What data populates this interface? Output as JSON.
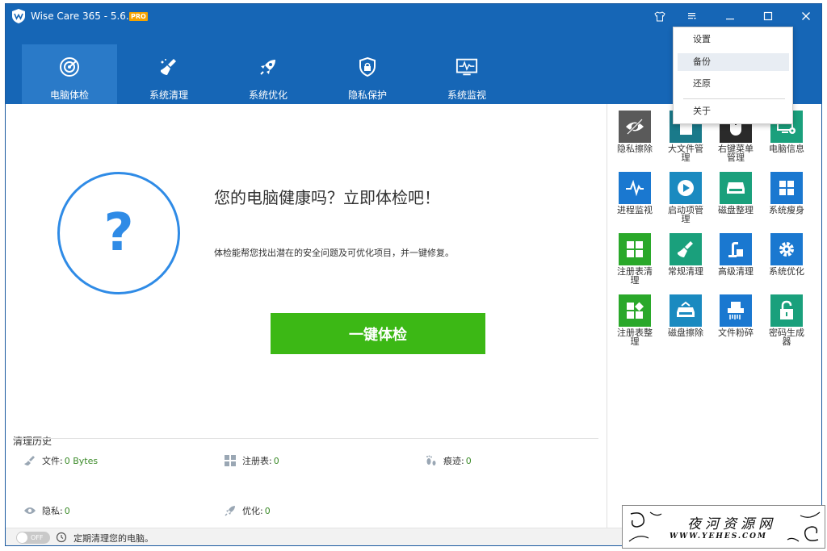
{
  "app": {
    "title": "Wise Care 365 - 5.6.4",
    "badge": "PRO"
  },
  "nav": [
    {
      "label": "电脑体检",
      "icon": "radar-icon",
      "active": true
    },
    {
      "label": "系统清理",
      "icon": "broom-icon"
    },
    {
      "label": "系统优化",
      "icon": "rocket-icon"
    },
    {
      "label": "隐私保护",
      "icon": "shield-lock-icon"
    },
    {
      "label": "系统监视",
      "icon": "monitor-pulse-icon"
    }
  ],
  "main": {
    "headline": "您的电脑健康吗？立即体检吧！",
    "description": "体检能帮您找出潜在的安全问题及可优化项目，并一键修复。",
    "scan_button": "一键体检",
    "circle_symbol": "?"
  },
  "history": {
    "title": "清理历史",
    "files_label": "文件:",
    "files_value": "0 Bytes",
    "registry_label": "注册表:",
    "registry_value": "0",
    "traces_label": "痕迹:",
    "traces_value": "0",
    "privacy_label": "隐私:",
    "privacy_value": "0",
    "optimize_label": "优化:",
    "optimize_value": "0"
  },
  "tools": [
    {
      "label": "隐私擦除",
      "color": "#5a5a5a",
      "icon": "eye-slash-icon"
    },
    {
      "label": "大文件管理",
      "color": "#1a7a8a",
      "icon": "file-icon"
    },
    {
      "label": "右键菜单管理",
      "color": "#2a2a2a",
      "icon": "mouse-icon"
    },
    {
      "label": "电脑信息",
      "color": "#1aa07c",
      "icon": "computer-info-icon"
    },
    {
      "label": "进程监视",
      "color": "#1a78d0",
      "icon": "pulse-icon"
    },
    {
      "label": "启动项管理",
      "color": "#1a8ac0",
      "icon": "play-icon"
    },
    {
      "label": "磁盘整理",
      "color": "#1aa07c",
      "icon": "disk-icon"
    },
    {
      "label": "系统瘦身",
      "color": "#1a78d0",
      "icon": "windows-icon"
    },
    {
      "label": "注册表清理",
      "color": "#2aa82a",
      "icon": "grid-icon"
    },
    {
      "label": "常规清理",
      "color": "#1aa07c",
      "icon": "broom-icon"
    },
    {
      "label": "高级清理",
      "color": "#1a78d0",
      "icon": "vacuum-icon"
    },
    {
      "label": "系统优化",
      "color": "#1a78d0",
      "icon": "gear-icon"
    },
    {
      "label": "注册表整理",
      "color": "#2aa82a",
      "icon": "grid-diamond-icon"
    },
    {
      "label": "磁盘擦除",
      "color": "#1a8ac0",
      "icon": "disk-wipe-icon"
    },
    {
      "label": "文件粉碎",
      "color": "#1a78d0",
      "icon": "shredder-icon"
    },
    {
      "label": "密码生成器",
      "color": "#1aa07c",
      "icon": "lock-icon"
    }
  ],
  "menu": {
    "settings": "设置",
    "backup": "备份",
    "restore": "还原",
    "about": "关于"
  },
  "bottom": {
    "toggle": "OFF",
    "schedule": "定期清理您的电脑。"
  },
  "watermark": {
    "title": "夜河资源网",
    "url": "WWW.YEHES.COM"
  },
  "colors": {
    "header": "#1666b6",
    "accent_green": "#3cb815",
    "circle": "#2f8be6"
  }
}
